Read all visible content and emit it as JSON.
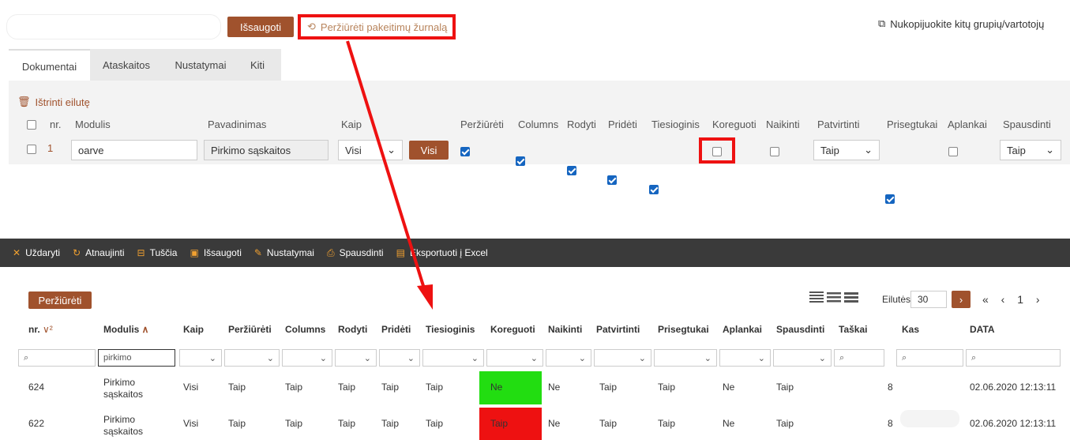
{
  "top": {
    "save_label": "Išsaugoti",
    "changelog_label": "Peržiūrėti pakeitimų žurnalą",
    "copy_label": "Nukopijuokite kitų grupių/vartotojų",
    "tabs": [
      "Dokumentai",
      "Ataskaitos",
      "Nustatymai",
      "Kiti"
    ],
    "delete_row_label": "Ištrinti eilutę",
    "headers": [
      "nr.",
      "Modulis",
      "Pavadinimas",
      "Kaip",
      "Peržiūrėti",
      "Columns",
      "Rodyti",
      "Pridėti",
      "Tiesioginis",
      "Koreguoti",
      "Naikinti",
      "Patvirtinti",
      "Prisegtukai",
      "Aplankai",
      "Spausdinti"
    ],
    "row": {
      "nr": "1",
      "modulis": "oarve",
      "pavadinimas": "Pirkimo sąskaitos",
      "kaip": "Visi",
      "visi_btn": "Visi",
      "patvirtinti": "Taip",
      "spausdinti": "Taip"
    }
  },
  "toolbar": {
    "close": "Uždaryti",
    "refresh": "Atnaujinti",
    "clear": "Tuščia",
    "save": "Išsaugoti",
    "settings": "Nustatymai",
    "print": "Spausdinti",
    "export": "Eksportuoti į Excel"
  },
  "grid": {
    "view_label": "Peržiūrėti",
    "rows_label": "Eilutės:",
    "rows_value": "30",
    "pager": "« ‹ 1 ›",
    "headers": [
      "nr.",
      "Modulis",
      "Kaip",
      "Peržiūrėti",
      "Columns",
      "Rodyti",
      "Pridėti",
      "Tiesioginis",
      "Koreguoti",
      "Naikinti",
      "Patvirtinti",
      "Prisegtukai",
      "Aplankai",
      "Spausdinti",
      "Taškai",
      "Kas",
      "DATA"
    ],
    "nr_sort": "∨²",
    "modulis_sort": "∧",
    "filter_modulis": "pirkimo",
    "rows": [
      {
        "nr": "624",
        "modulis": "Pirkimo sąskaitos",
        "kaip": "Visi",
        "perziureti": "Taip",
        "columns": "Taip",
        "rodyti": "Taip",
        "prideti": "Taip",
        "tiesioginis": "Taip",
        "koreguoti": "Ne",
        "naikinti": "Ne",
        "patvirtinti": "Taip",
        "prisegtukai": "Taip",
        "aplankai": "Ne",
        "spausdinti": "Taip",
        "taskai": "",
        "kas": "8",
        "data": "02.06.2020 12:13:11"
      },
      {
        "nr": "622",
        "modulis": "Pirkimo sąskaitos",
        "kaip": "Visi",
        "perziureti": "Taip",
        "columns": "Taip",
        "rodyti": "Taip",
        "prideti": "Taip",
        "tiesioginis": "Taip",
        "koreguoti": "Taip",
        "naikinti": "Ne",
        "patvirtinti": "Taip",
        "prisegtukai": "Taip",
        "aplankai": "Ne",
        "spausdinti": "Taip",
        "taskai": "",
        "kas": "8",
        "data": "02.06.2020 12:13:11"
      }
    ],
    "colors": {
      "koreguoti_row1": "#22dd11",
      "koreguoti_row2": "#ee1111"
    }
  },
  "icons": [
    "history-icon",
    "copy-icon",
    "trash-icon",
    "close-icon",
    "refresh-icon",
    "clear-icon",
    "save-icon",
    "wrench-icon",
    "print-icon",
    "excel-icon",
    "search-icon",
    "chevron-down-icon"
  ]
}
